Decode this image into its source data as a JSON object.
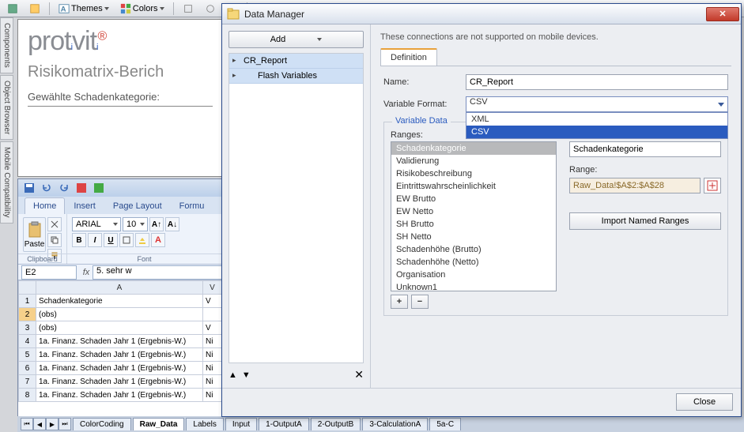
{
  "toolbar": {
    "themes_label": "Themes",
    "colors_label": "Colors"
  },
  "side_tabs": [
    "Components",
    "Object Browser",
    "Mobile Compatibility"
  ],
  "document": {
    "logo_text": "protiviti",
    "heading": "Risikomatrix-Berich",
    "subheading": "Gewählte Schadenkategorie:"
  },
  "excel": {
    "ribbon_tabs": [
      "Home",
      "Insert",
      "Page Layout",
      "Formu"
    ],
    "active_ribbon_tab": "Home",
    "font_name": "ARIAL",
    "font_size": "10",
    "group_clipboard": "Clipboard",
    "group_font": "Font",
    "paste_label": "Paste",
    "namebox": "E2",
    "formula": "5. sehr w",
    "col_headers": [
      "",
      "A",
      "V"
    ],
    "rows": [
      {
        "n": "1",
        "a": "Schadenkategorie",
        "b": "V"
      },
      {
        "n": "2",
        "a": "(obs)",
        "b": ""
      },
      {
        "n": "3",
        "a": "(obs)",
        "b": "V"
      },
      {
        "n": "4",
        "a": "1a. Finanz. Schaden Jahr 1 (Ergebnis-W.)",
        "b": "Ni"
      },
      {
        "n": "5",
        "a": "1a. Finanz. Schaden Jahr 1 (Ergebnis-W.)",
        "b": "Ni"
      },
      {
        "n": "6",
        "a": "1a. Finanz. Schaden Jahr 1 (Ergebnis-W.)",
        "b": "Ni"
      },
      {
        "n": "7",
        "a": "1a. Finanz. Schaden Jahr 1 (Ergebnis-W.)",
        "b": "Ni"
      },
      {
        "n": "8",
        "a": "1a. Finanz. Schaden Jahr 1 (Ergebnis-W.)",
        "b": "Ni"
      }
    ],
    "selected_row": "2",
    "sheet_tabs": [
      "ColorCoding",
      "Raw_Data",
      "Labels",
      "Input",
      "1-OutputA",
      "2-OutputB",
      "3-CalculationA",
      "5a-C"
    ],
    "active_sheet": "Raw_Data"
  },
  "dialog": {
    "title": "Data Manager",
    "add_label": "Add",
    "tree": {
      "name": "CR_Report",
      "child": "Flash Variables"
    },
    "hint": "These connections are not supported on mobile devices.",
    "tab_definition": "Definition",
    "name_label": "Name:",
    "name_value": "CR_Report",
    "format_label": "Variable Format:",
    "format_selected": "CSV",
    "format_options": [
      "XML",
      "CSV"
    ],
    "format_highlighted": "CSV",
    "fieldset_label": "Variable Data",
    "ranges_label": "Ranges:",
    "ranges": [
      "Schadenkategorie",
      "Validierung",
      "Risikobeschreibung",
      "Eintrittswahrscheinlichkeit",
      "EW Brutto",
      "EW Netto",
      "SH Brutto",
      "SH Netto",
      "Schadenhöhe (Brutto)",
      "Schadenhöhe (Netto)",
      "Organisation",
      "Unknown1"
    ],
    "selected_range": "Schadenkategorie",
    "right_name_value": "Schadenkategorie",
    "range_label": "Range:",
    "range_value": "Raw_Data!$A$2:$A$28",
    "import_label": "Import Named Ranges",
    "close_label": "Close"
  }
}
